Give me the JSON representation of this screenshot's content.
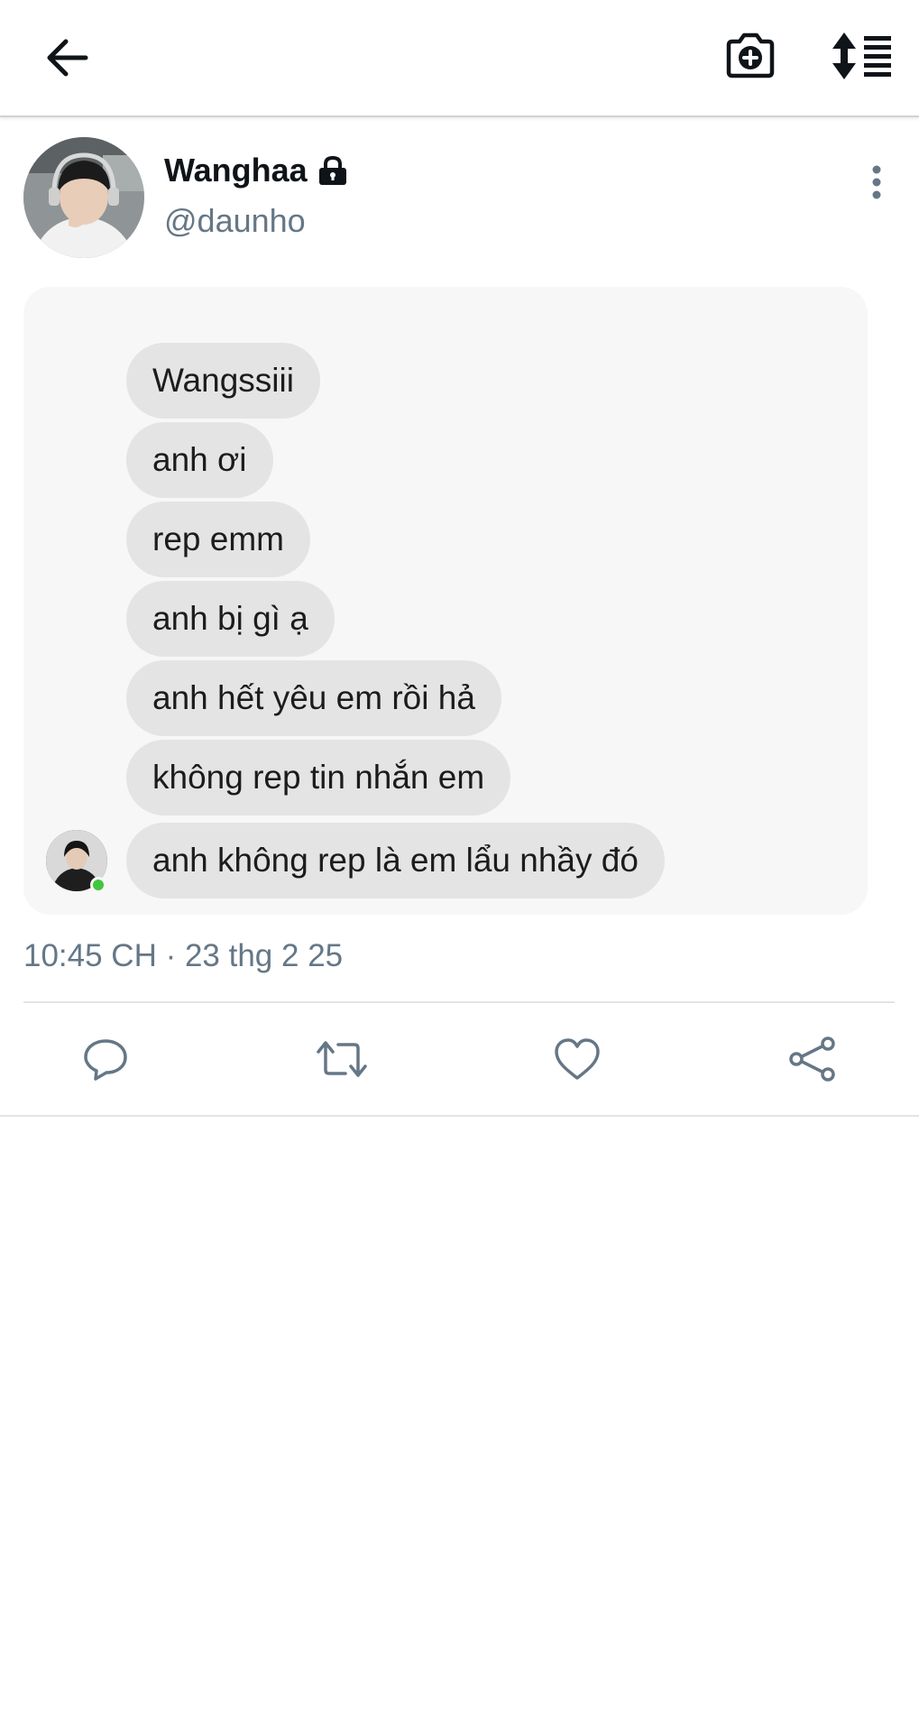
{
  "header": {
    "back_icon": "arrow-left-icon",
    "camera_icon": "camera-plus-icon",
    "sort_icon": "sort-list-icon"
  },
  "tweet": {
    "display_name": "Wanghaa",
    "protected_icon": "lock-icon",
    "handle": "@daunho",
    "more_icon": "vertical-dots-icon",
    "timestamp": "10:45 CH · 23 thg 2 25"
  },
  "chat_image": {
    "messages": [
      "Wangssiii",
      "anh ơi",
      "rep emm",
      "anh bị gì ạ",
      "anh hết yêu em rồi hả",
      "không rep tin nhắn em",
      "anh không rep là em lẩu nhầy đó"
    ],
    "online_status_color": "#42c63d"
  },
  "actions": {
    "reply_icon": "reply-icon",
    "retweet_icon": "retweet-icon",
    "like_icon": "heart-icon",
    "share_icon": "share-icon"
  },
  "colors": {
    "secondary_text": "#657786",
    "bubble": "#e4e4e4"
  }
}
